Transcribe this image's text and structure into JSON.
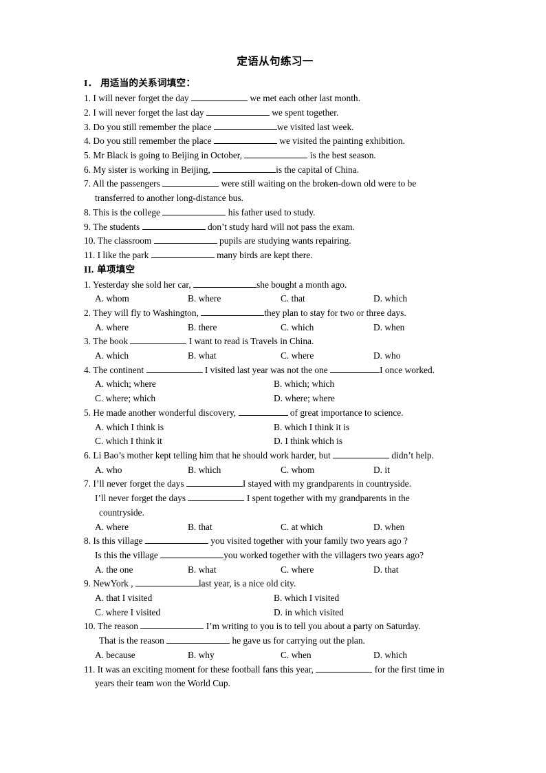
{
  "document": {
    "title": "定语从句练习一"
  },
  "sections": [
    {
      "number": "I．",
      "label": "用适当的关系词填空：",
      "items": [
        {
          "num": "1.",
          "pre": "I will never forget the day",
          "blank": "b-l",
          "post": "we met each other last month."
        },
        {
          "num": "2.",
          "pre": "I will never forget the last day",
          "blank": "b-xl",
          "post": "we spent together."
        },
        {
          "num": "3.",
          "pre": "Do you still remember the place",
          "blank": "b-xl",
          "post": "we visited last week."
        },
        {
          "num": "4.",
          "pre": "Do you still remember the place",
          "blank": "b-xl",
          "post": "we visited the painting exhibition."
        },
        {
          "num": "5.",
          "pre": "Mr Black is going to Beijing in October,",
          "blank": "b-xl",
          "post": "is the best season."
        },
        {
          "num": "6.",
          "pre": "My sister is working in Beijing,",
          "blank": "b-xl",
          "post": "is the capital of China."
        },
        {
          "num": "7.",
          "pre": "All the passengers",
          "blank": "b-l",
          "post": "were still waiting on the broken-down old were to be",
          "cont": "transferred to another long-distance bus."
        },
        {
          "num": "8.",
          "pre": "This is the college",
          "blank": "b-xl",
          "post": "his father used to study."
        },
        {
          "num": "9.",
          "pre": "The students",
          "blank": "b-xl",
          "post": "don’t study hard will not pass the exam."
        },
        {
          "num": "10.",
          "pre": "The classroom",
          "blank": "b-xl",
          "post": "pupils are studying wants repairing."
        },
        {
          "num": "11.",
          "pre": "I like the park",
          "blank": "b-xl",
          "post": "many birds are kept there."
        }
      ]
    },
    {
      "number": "II.",
      "label": "单项填空",
      "items": [
        {
          "num": "1.",
          "pre": "Yesterday she sold her car,",
          "blank": "b-xl",
          "post": "she bought a month ago.",
          "columns": 4,
          "options": [
            "A. whom",
            "B. where",
            "C. that",
            "D. which"
          ]
        },
        {
          "num": "2.",
          "pre": "They will fly to Washington,",
          "blank": "b-xl",
          "post": "they plan to stay for two or three days.",
          "columns": 4,
          "options": [
            "A. where",
            "B. there",
            "C. which",
            "D. when"
          ]
        },
        {
          "num": "3.",
          "pre": "The book",
          "blank": "b-l",
          "post": "I want to read is Travels in China.",
          "columns": 4,
          "options": [
            "A. which",
            "B. what",
            "C. where",
            "D. who"
          ]
        },
        {
          "num": "4.",
          "pre": "The continent",
          "blank": "b-l",
          "post": "I visited last year was not the one",
          "blank2": "b-m",
          "post2": "I once worked.",
          "columns": 2,
          "options": [
            "A. which; where",
            "B. which; which",
            "C. where; which",
            "D. where; where"
          ]
        },
        {
          "num": "5.",
          "pre": "He made another wonderful discovery,",
          "blank": "b-m",
          "post": "of great importance to science.",
          "columns": 2,
          "options": [
            "A. which I think is",
            "B. which I think it is",
            "C. which I think it",
            "D. I think which is"
          ]
        },
        {
          "num": "6.",
          "pre": "Li Bao’s mother kept telling him that he should work harder, but",
          "blank": "b-l",
          "post": "didn’t help.",
          "columns": 4,
          "options": [
            "A. who",
            "B. which",
            "C. whom",
            "D. it"
          ]
        },
        {
          "num": "7.",
          "pre": "I’ll never forget the days",
          "blank": "b-l",
          "post": "I stayed with my grandparents in countryside.",
          "sub_pre": "I’ll never forget the days",
          "sub_blank": "b-l",
          "sub_post": "I spent together with my grandparents in the",
          "sub_cont": "countryside.",
          "columns": 4,
          "options": [
            "A. where",
            "B. that",
            "C. at which",
            "D. when"
          ]
        },
        {
          "num": "8.",
          "pre": "Is this village",
          "blank": "b-xl",
          "post": "you visited together with your family two years ago ?",
          "sub_pre": "Is this the village",
          "sub_blank": "b-xl",
          "sub_post": "you worked together with the villagers two years ago?",
          "columns": 4,
          "options": [
            "A. the one",
            "B. what",
            "C. where",
            "D. that"
          ]
        },
        {
          "num": "9.",
          "pre": "NewYork ,",
          "blank": "b-xl",
          "post": "last year, is a nice old city.",
          "columns": 2,
          "options": [
            "A. that I visited",
            "B. which I visited",
            "C. where I visited",
            "D. in which visited"
          ]
        },
        {
          "num": "10.",
          "pre": "The reason",
          "blank": "b-xl",
          "post": "I’m writing to you is to tell you about a party on Saturday.",
          "sub_pre": "That is the reason",
          "sub_blank": "b-xl",
          "sub_post": "he gave us for carrying out the plan.",
          "columns": 4,
          "options": [
            "A. because",
            "B. why",
            "C. when",
            "D. which"
          ]
        },
        {
          "num": "11.",
          "pre": "It was an exciting moment for these football fans this year,",
          "blank": "b-l",
          "post": "for the first time in",
          "cont": "years their team won the World Cup."
        }
      ]
    }
  ]
}
